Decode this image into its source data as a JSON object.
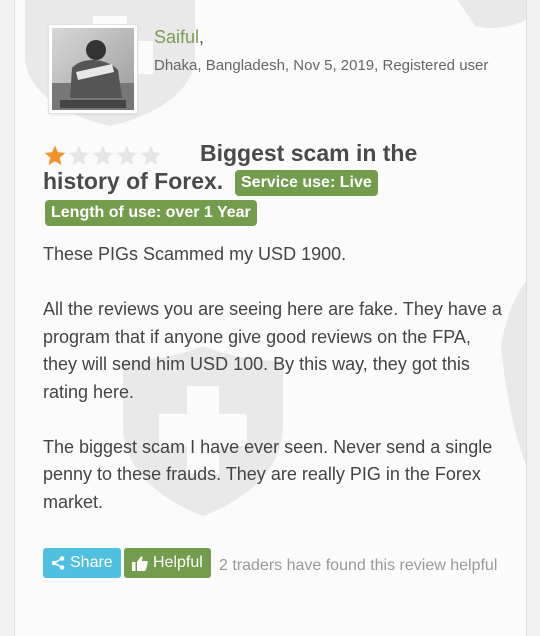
{
  "author": {
    "name": "Saiful",
    "meta": "Dhaka, Bangladesh, Nov 5, 2019, Registered user"
  },
  "review": {
    "rating": 1,
    "max_rating": 5,
    "title_line1": "Biggest scam in the",
    "title_line2": "history of Forex.",
    "service_use": "Service use: Live",
    "length_of_use": "Length of use: over 1 Year",
    "paragraphs": [
      "These PIGs Scammed my USD 1900.",
      "All the reviews you are seeing here are fake. They have a program that if anyone give good reviews on the FPA, they will send him USD 100. By this way, they got this rating here.",
      "The biggest scam I have ever seen. Never send a single penny to these frauds. They are really PIG in the Forex market."
    ]
  },
  "actions": {
    "share_label": "Share",
    "helpful_label": "Helpful",
    "helpful_count_text": "2 traders have found this review helpful"
  },
  "icons": {
    "share": "share-icon",
    "helpful": "thumbs-up-icon",
    "star_filled": "star-filled-icon",
    "star_empty": "star-empty-icon",
    "watermark": "shield-cross-watermark"
  },
  "colors": {
    "accent_green": "#749c4d",
    "author_name": "#7d9c55",
    "share_blue": "#4fc0df",
    "star_filled": "#f0932b",
    "star_empty": "#e6e6e6"
  }
}
